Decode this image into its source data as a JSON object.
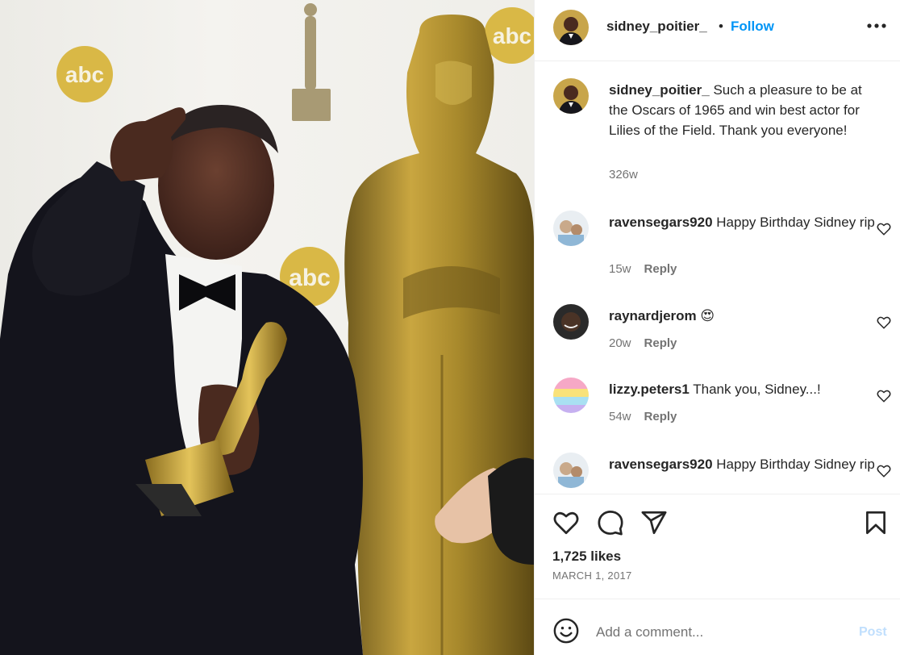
{
  "post": {
    "photo_watermark": "abc",
    "author": {
      "username": "sidney_poitier_",
      "separator": "•",
      "follow_label": "Follow",
      "more_icon": "more-horizontal-icon"
    },
    "caption": {
      "username": "sidney_poitier_",
      "text": "Such a pleasure to be at the Oscars of 1965 and win best actor for Lilies of the Field. Thank you everyone!",
      "time": "326w"
    },
    "comments": [
      {
        "username": "ravensegars920",
        "text": "Happy Birthday Sidney rip",
        "time": "15w",
        "reply_label": "Reply"
      },
      {
        "username": "raynardjerom",
        "text": "😍",
        "time": "20w",
        "reply_label": "Reply"
      },
      {
        "username": "lizzy.peters1",
        "text": "Thank you, Sidney...!",
        "time": "54w",
        "reply_label": "Reply"
      },
      {
        "username": "ravensegars920",
        "text": "Happy Birthday Sidney rip",
        "time": "",
        "reply_label": ""
      }
    ],
    "actions": {
      "icons": [
        "heart-icon",
        "comment-icon",
        "share-icon",
        "bookmark-icon"
      ],
      "likes": "1,725 likes",
      "date": "MARCH 1, 2017"
    },
    "add_comment": {
      "placeholder": "Add a comment...",
      "post_label": "Post",
      "emoji_icon": "emoji-icon"
    },
    "colors": {
      "link_blue": "#0095f6",
      "post_disabled": "#c0dffd",
      "secondary_text": "#737373"
    }
  }
}
